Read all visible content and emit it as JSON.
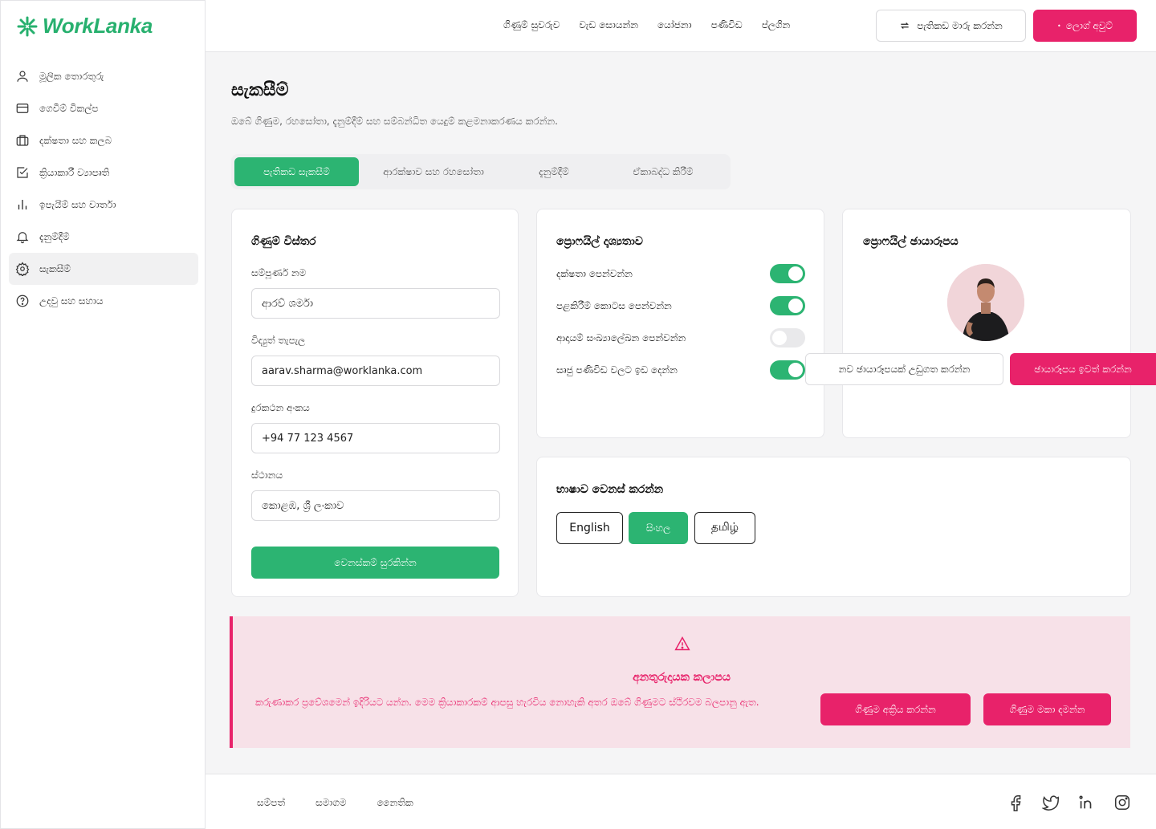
{
  "brand": {
    "name": "WorkLanka",
    "color": "#27b06e"
  },
  "colors": {
    "primary": "#2cb472",
    "danger": "#e8226a",
    "danger_bg": "#f7e1e8"
  },
  "sidebar": {
    "items": [
      {
        "label": "මූලික තොරතුරු",
        "icon": "user-icon"
      },
      {
        "label": "ගෙවීම් විකල්ප",
        "icon": "credit-card-icon"
      },
      {
        "label": "දක්ෂතා සහ කලබ",
        "icon": "briefcase-icon"
      },
      {
        "label": "ක්‍රියාකාරී ව්‍යාපෘති",
        "icon": "checkbox-icon"
      },
      {
        "label": "ඉපැයීම් සහ වාර්තා",
        "icon": "bar-chart-icon"
      },
      {
        "label": "දැනුම්දීම්",
        "icon": "bell-icon"
      },
      {
        "label": "සැකසීම්",
        "icon": "gear-icon",
        "active": true
      },
      {
        "label": "උදවු සහ සහාය",
        "icon": "help-circle-icon"
      }
    ]
  },
  "header": {
    "nav": [
      "ගිණුම් සුවරුව",
      "වැඩ සොයන්න",
      "යෝජනා",
      "පණිවිඩ",
      "ප්ලගින"
    ],
    "switch_label": "පැතිකඩ මාරු කරන්න",
    "logout_label": "ලොග් අවුට්"
  },
  "page": {
    "title": "සැකසීම්",
    "subtitle": "ඔබේ ගිණුම, රහසෝතා, දැනුම්දීම් සහ සම්බන්ධිත යෙදුම් කළමනාකරණය කරන්න."
  },
  "tabs": [
    {
      "label": "පැතිකඩ සැකසීම්",
      "active": true
    },
    {
      "label": "ආරක්ෂාව සහ රහසෝතා"
    },
    {
      "label": "දැනුම්දීම්"
    },
    {
      "label": "ඒකාබද්ධ කිරීම්"
    }
  ],
  "account": {
    "title": "ගිණුම් විස්තර",
    "name_label": "සම්පූර්ණ නම",
    "name_value": "ආරව් ශර්මා",
    "email_label": "විද්‍යුත් තැපැල",
    "email_value": "aarav.sharma@worklanka.com",
    "phone_label": "දුරකථන අංකය",
    "phone_value": "+94 77 123 4567",
    "location_label": "ස්ථානය",
    "location_value": "කොළඹ, ශ්‍රී ලංකාව",
    "save_label": "වෙනස්කම් සුරකින්න"
  },
  "visibility": {
    "title": "ප්‍රොෆයිල් දෘශ්‍යතාව",
    "toggles": [
      {
        "label": "දක්ෂතා පෙන්වන්න",
        "on": true
      },
      {
        "label": "පළකිරීම් කොටස පෙන්වන්න",
        "on": true
      },
      {
        "label": "ආදායම් සංඛ්‍යාලේඛන පෙන්වන්න",
        "on": false
      },
      {
        "label": "සෘජු පණිවිඩ වලට ඉඩ දෙන්න",
        "on": true
      }
    ]
  },
  "photo": {
    "title": "ප්‍රොෆයිල් ඡායාරූපය",
    "upload_label": "නව ඡායාරූපයක් උඩුගත කරන්න",
    "remove_label": "ඡායාරූපය ඉවත් කරන්න"
  },
  "language": {
    "title": "භාෂාව වෙනස් කරන්න",
    "options": [
      {
        "label": "English"
      },
      {
        "label": "සිංහල",
        "active": true
      },
      {
        "label": "தமிழ்"
      }
    ]
  },
  "danger": {
    "title": "අනතුරුදායක කලාපය",
    "text": "කරුණාකර ප්‍රවේශමෙන් ඉදිරියට යන්න. මෙම ක්‍රියාකාරකම් ආපසු හැරවිය නොහැකි අතර ඔබේ ගිණුමට ස්ථිරවම බලපානු ඇත.",
    "deactivate_label": "ගිණුම අක්‍රිය කරන්න",
    "delete_label": "ගිණුම මකා දමන්න"
  },
  "footer": {
    "links": [
      "සම්පත්",
      "සමාගම",
      "නෛතික"
    ],
    "social": [
      "facebook-icon",
      "twitter-icon",
      "linkedin-icon",
      "instagram-icon"
    ]
  }
}
